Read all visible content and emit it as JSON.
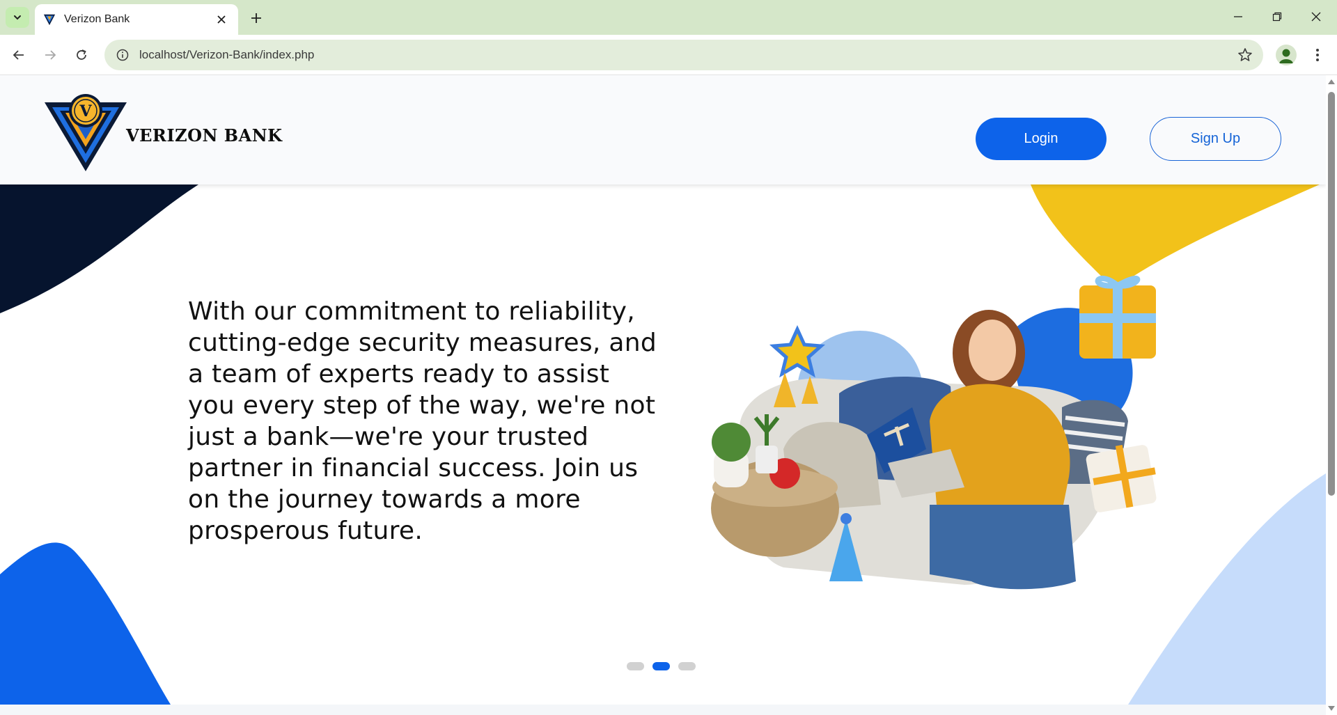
{
  "browser": {
    "tab_title": "Verizon Bank",
    "url": "localhost/Verizon-Bank/index.php"
  },
  "header": {
    "brand_name": "VERIZON BANK",
    "logo_letter": "V",
    "login_label": "Login",
    "signup_label": "Sign Up"
  },
  "hero": {
    "text": "With our commitment to reliability, cutting-edge security measures, and a team of experts ready to assist you every step of the way, we're not just a bank—we're your trusted partner in financial success. Join us on the journey towards a more prosperous future."
  },
  "carousel": {
    "slide_count": 3,
    "active_slide": 2
  },
  "colors": {
    "accent_blue": "#0d63ea",
    "yellow": "#f2c21a",
    "navy": "#06142e",
    "light_blue": "#c6dcfb"
  },
  "icons": [
    "tab-search-icon",
    "close-icon",
    "plus-icon",
    "minimize-icon",
    "restore-icon",
    "back-icon",
    "forward-icon",
    "reload-icon",
    "info-icon",
    "star-icon",
    "profile-icon",
    "menu-dots-icon"
  ]
}
